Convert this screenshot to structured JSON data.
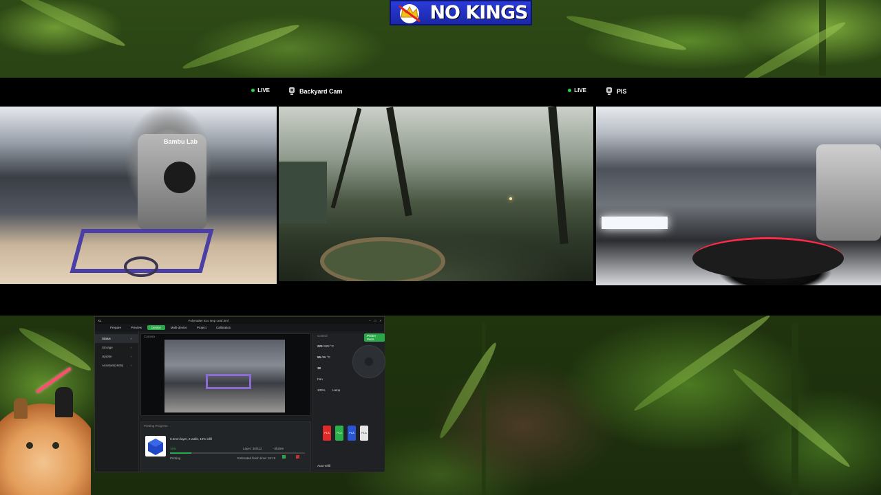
{
  "banner": {
    "text": "NO KINGS"
  },
  "cameras": [
    {
      "title": "",
      "live_label": "LIVE"
    },
    {
      "title": "Backyard Cam",
      "live_label": "LIVE"
    },
    {
      "title": "PIS",
      "live_label": ""
    }
  ],
  "printer_label": "Bambu Lab",
  "app": {
    "titlebar": {
      "device": "X1",
      "title": "Polymaker Eco Hop Leaf.3mf"
    },
    "tabs": [
      {
        "label": "Prepare"
      },
      {
        "label": "Preview"
      },
      {
        "label": "Device"
      },
      {
        "label": "Multi-device"
      },
      {
        "label": "Project"
      },
      {
        "label": "Calibration"
      }
    ],
    "sidebar": [
      {
        "label": "Status"
      },
      {
        "label": "Storage"
      },
      {
        "label": "Update"
      },
      {
        "label": "Assistant(HMS)"
      }
    ],
    "camera_panel": {
      "label": "Camera",
      "status": "Playing..."
    },
    "progress": {
      "header": "Printing Progress",
      "job": "0.2mm layer, 2 walls, 10% infill",
      "percent": "16%",
      "layer": "Layer: 30/312",
      "remaining": "-3h29m",
      "state": "Printing",
      "finish": "Estimated finish time: 04:19",
      "progress_fraction": 0.16
    },
    "control": {
      "header": "Control",
      "printer_parts": "Printer Parts",
      "nozzle": "220",
      "nozzle_target": "/220 °C",
      "bed": "55",
      "bed_target": "/55 °C",
      "chamber": "38",
      "fan": "Fan",
      "speed": "100%",
      "lamp": "Lamp",
      "auto_refill": "Auto-refill",
      "ams": [
        {
          "label": "PLA",
          "color": "#e02a2a"
        },
        {
          "label": "PLA",
          "color": "#2ab24a"
        },
        {
          "label": "PLA",
          "color": "#2a56d6"
        },
        {
          "label": "PLA",
          "color": "#e6e6e6"
        }
      ]
    }
  },
  "colors": {
    "accent_green": "#2aa84a",
    "banner_blue": "#1f2fc0",
    "live_dot": "#2fd34a"
  }
}
